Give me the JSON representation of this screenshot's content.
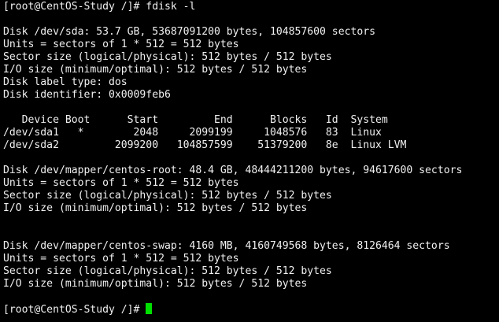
{
  "terminal": {
    "colors": {
      "background": "#000000",
      "foreground": "#f0f0f0",
      "cursor": "#00e000"
    },
    "prompt1": "[root@CentOS-Study /]# fdisk -l",
    "sda": {
      "disk": "Disk /dev/sda: 53.7 GB, 53687091200 bytes, 104857600 sectors",
      "units": "Units = sectors of 1 * 512 = 512 bytes",
      "sector_size": "Sector size (logical/physical): 512 bytes / 512 bytes",
      "io_size": "I/O size (minimum/optimal): 512 bytes / 512 bytes",
      "label_type": "Disk label type: dos",
      "identifier": "Disk identifier: 0x0009feb6"
    },
    "partitions": {
      "header": "   Device Boot      Start         End      Blocks   Id  System",
      "rows": [
        "/dev/sda1   *        2048     2099199     1048576   83  Linux",
        "/dev/sda2         2099200   104857599    51379200   8e  Linux LVM"
      ]
    },
    "centos_root": {
      "disk": "Disk /dev/mapper/centos-root: 48.4 GB, 48444211200 bytes, 94617600 sectors",
      "units": "Units = sectors of 1 * 512 = 512 bytes",
      "sector_size": "Sector size (logical/physical): 512 bytes / 512 bytes",
      "io_size": "I/O size (minimum/optimal): 512 bytes / 512 bytes"
    },
    "centos_swap": {
      "disk": "Disk /dev/mapper/centos-swap: 4160 MB, 4160749568 bytes, 8126464 sectors",
      "units": "Units = sectors of 1 * 512 = 512 bytes",
      "sector_size": "Sector size (logical/physical): 512 bytes / 512 bytes",
      "io_size": "I/O size (minimum/optimal): 512 bytes / 512 bytes"
    },
    "prompt2": "[root@CentOS-Study /]# "
  }
}
